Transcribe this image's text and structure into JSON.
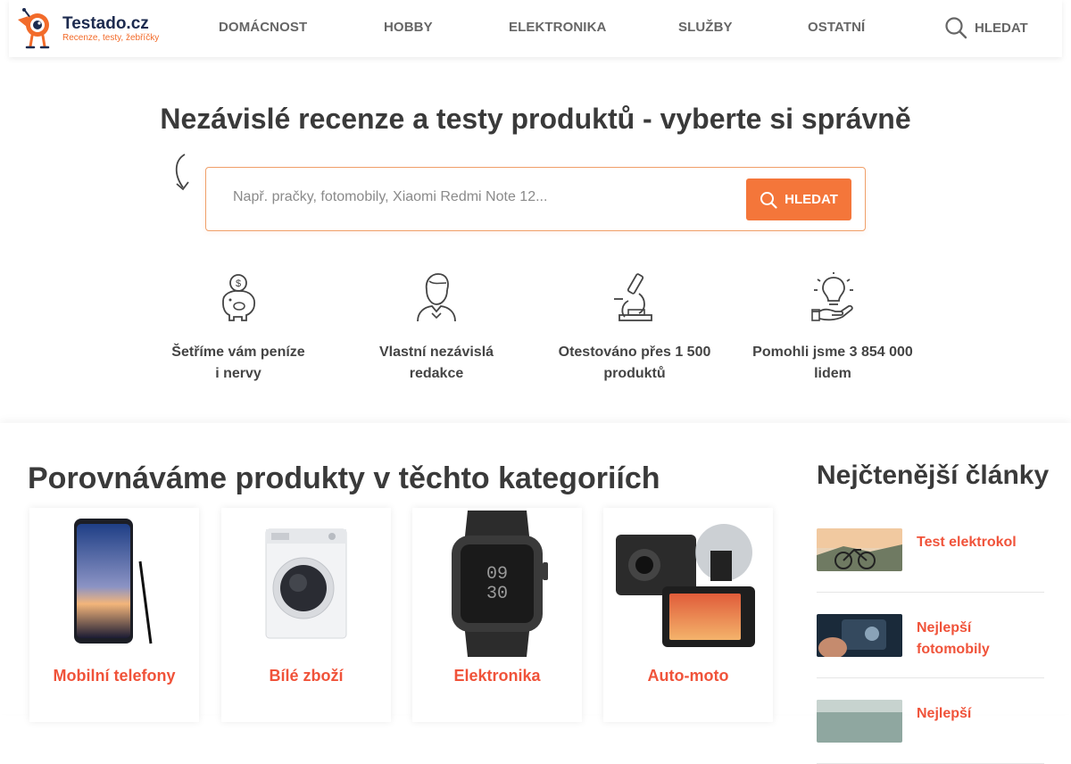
{
  "brand": {
    "name": "Testado.cz",
    "tagline": "Recenze, testy, žebříčky",
    "accent": "#f4763a",
    "link_color": "#f0533a"
  },
  "nav": {
    "items": [
      {
        "label": "DOMÁCNOST"
      },
      {
        "label": "HOBBY"
      },
      {
        "label": "ELEKTRONIKA"
      },
      {
        "label": "SLUŽBY"
      },
      {
        "label": "OSTATNÍ"
      }
    ],
    "search_label": "HLEDAT"
  },
  "hero": {
    "title": "Nezávislé recenze a testy produktů - vyberte si správně",
    "search_placeholder": "Např. pračky, fotomobily, Xiaomi Redmi Note 12...",
    "search_button": "HLEDAT"
  },
  "features": [
    {
      "icon": "piggy-bank-icon",
      "label_1": "Šetříme vám peníze",
      "label_2": "i nervy"
    },
    {
      "icon": "editor-person-icon",
      "label_1": "Vlastní nezávislá",
      "label_2": "redakce"
    },
    {
      "icon": "microscope-icon",
      "label_1": "Otestováno přes 1 500",
      "label_2": "produktů"
    },
    {
      "icon": "lightbulb-hand-icon",
      "label_1": "Pomohli jsme 3 854 000",
      "label_2": "lidem"
    }
  ],
  "categories": {
    "title": "Porovnáváme produkty v těchto kategoriích",
    "items": [
      {
        "label": "Mobilní telefony",
        "image": "smartphone"
      },
      {
        "label": "Bílé zboží",
        "image": "washing-machine"
      },
      {
        "label": "Elektronika",
        "image": "smartwatch"
      },
      {
        "label": "Auto-moto",
        "image": "dashcam"
      }
    ]
  },
  "articles": {
    "title": "Nejčtenější články",
    "items": [
      {
        "title": "Test elektrokol"
      },
      {
        "title": "Nejlepší fotomobily"
      },
      {
        "title": "Nejlepší"
      }
    ]
  }
}
